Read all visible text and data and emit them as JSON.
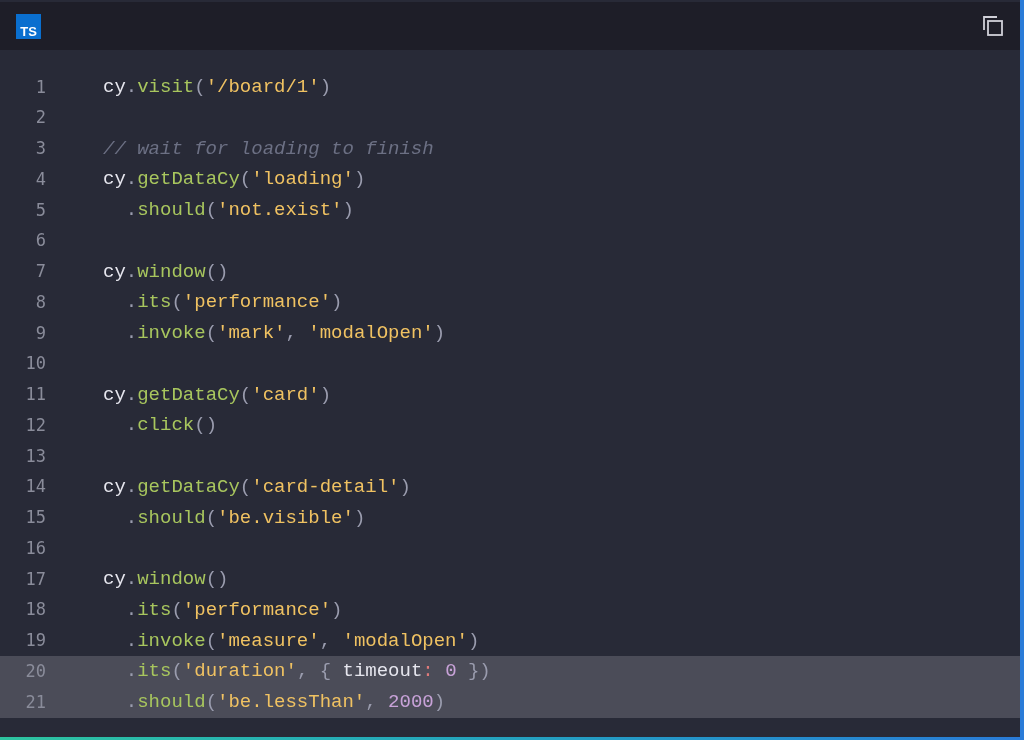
{
  "header": {
    "badge": "TS"
  },
  "lines": [
    {
      "number": "1",
      "highlighted": false,
      "tokens": [
        {
          "kind": "plain",
          "text": "cy"
        },
        {
          "kind": "punct",
          "text": "."
        },
        {
          "kind": "func",
          "text": "visit"
        },
        {
          "kind": "punct",
          "text": "("
        },
        {
          "kind": "string",
          "text": "'/board/1'"
        },
        {
          "kind": "punct",
          "text": ")"
        }
      ]
    },
    {
      "number": "2",
      "highlighted": false
    },
    {
      "number": "3",
      "highlighted": false,
      "tokens": [
        {
          "kind": "comment",
          "text": "// wait for loading to finish"
        }
      ]
    },
    {
      "number": "4",
      "highlighted": false,
      "tokens": [
        {
          "kind": "plain",
          "text": "cy"
        },
        {
          "kind": "punct",
          "text": "."
        },
        {
          "kind": "func",
          "text": "getDataCy"
        },
        {
          "kind": "punct",
          "text": "("
        },
        {
          "kind": "string",
          "text": "'loading'"
        },
        {
          "kind": "punct",
          "text": ")"
        }
      ]
    },
    {
      "number": "5",
      "highlighted": false,
      "tokens": [
        {
          "kind": "punct",
          "text": "  ."
        },
        {
          "kind": "func",
          "text": "should"
        },
        {
          "kind": "punct",
          "text": "("
        },
        {
          "kind": "string",
          "text": "'not.exist'"
        },
        {
          "kind": "punct",
          "text": ")"
        }
      ]
    },
    {
      "number": "6",
      "highlighted": false
    },
    {
      "number": "7",
      "highlighted": false,
      "tokens": [
        {
          "kind": "plain",
          "text": "cy"
        },
        {
          "kind": "punct",
          "text": "."
        },
        {
          "kind": "func",
          "text": "window"
        },
        {
          "kind": "punct",
          "text": "()"
        }
      ]
    },
    {
      "number": "8",
      "highlighted": false,
      "tokens": [
        {
          "kind": "punct",
          "text": "  ."
        },
        {
          "kind": "func",
          "text": "its"
        },
        {
          "kind": "punct",
          "text": "("
        },
        {
          "kind": "string",
          "text": "'performance'"
        },
        {
          "kind": "punct",
          "text": ")"
        }
      ]
    },
    {
      "number": "9",
      "highlighted": false,
      "tokens": [
        {
          "kind": "punct",
          "text": "  ."
        },
        {
          "kind": "func",
          "text": "invoke"
        },
        {
          "kind": "punct",
          "text": "("
        },
        {
          "kind": "string",
          "text": "'mark'"
        },
        {
          "kind": "punct",
          "text": ", "
        },
        {
          "kind": "string",
          "text": "'modalOpen'"
        },
        {
          "kind": "punct",
          "text": ")"
        }
      ]
    },
    {
      "number": "10",
      "highlighted": false
    },
    {
      "number": "11",
      "highlighted": false,
      "tokens": [
        {
          "kind": "plain",
          "text": "cy"
        },
        {
          "kind": "punct",
          "text": "."
        },
        {
          "kind": "func",
          "text": "getDataCy"
        },
        {
          "kind": "punct",
          "text": "("
        },
        {
          "kind": "string",
          "text": "'card'"
        },
        {
          "kind": "punct",
          "text": ")"
        }
      ]
    },
    {
      "number": "12",
      "highlighted": false,
      "tokens": [
        {
          "kind": "punct",
          "text": "  ."
        },
        {
          "kind": "func",
          "text": "click"
        },
        {
          "kind": "punct",
          "text": "()"
        }
      ]
    },
    {
      "number": "13",
      "highlighted": false
    },
    {
      "number": "14",
      "highlighted": false,
      "tokens": [
        {
          "kind": "plain",
          "text": "cy"
        },
        {
          "kind": "punct",
          "text": "."
        },
        {
          "kind": "func",
          "text": "getDataCy"
        },
        {
          "kind": "punct",
          "text": "("
        },
        {
          "kind": "string",
          "text": "'card-detail'"
        },
        {
          "kind": "punct",
          "text": ")"
        }
      ]
    },
    {
      "number": "15",
      "highlighted": false,
      "tokens": [
        {
          "kind": "punct",
          "text": "  ."
        },
        {
          "kind": "func",
          "text": "should"
        },
        {
          "kind": "punct",
          "text": "("
        },
        {
          "kind": "string",
          "text": "'be.visible'"
        },
        {
          "kind": "punct",
          "text": ")"
        }
      ]
    },
    {
      "number": "16",
      "highlighted": false
    },
    {
      "number": "17",
      "highlighted": false,
      "tokens": [
        {
          "kind": "plain",
          "text": "cy"
        },
        {
          "kind": "punct",
          "text": "."
        },
        {
          "kind": "func",
          "text": "window"
        },
        {
          "kind": "punct",
          "text": "()"
        }
      ]
    },
    {
      "number": "18",
      "highlighted": false,
      "tokens": [
        {
          "kind": "punct",
          "text": "  ."
        },
        {
          "kind": "func",
          "text": "its"
        },
        {
          "kind": "punct",
          "text": "("
        },
        {
          "kind": "string",
          "text": "'performance'"
        },
        {
          "kind": "punct",
          "text": ")"
        }
      ]
    },
    {
      "number": "19",
      "highlighted": false,
      "tokens": [
        {
          "kind": "punct",
          "text": "  ."
        },
        {
          "kind": "func",
          "text": "invoke"
        },
        {
          "kind": "punct",
          "text": "("
        },
        {
          "kind": "string",
          "text": "'measure'"
        },
        {
          "kind": "punct",
          "text": ", "
        },
        {
          "kind": "string",
          "text": "'modalOpen'"
        },
        {
          "kind": "punct",
          "text": ")"
        }
      ]
    },
    {
      "number": "20",
      "highlighted": true,
      "tokens": [
        {
          "kind": "punct",
          "text": "  ."
        },
        {
          "kind": "func",
          "text": "its"
        },
        {
          "kind": "punct",
          "text": "("
        },
        {
          "kind": "string",
          "text": "'duration'"
        },
        {
          "kind": "punct",
          "text": ", { "
        },
        {
          "kind": "plain",
          "text": "timeout"
        },
        {
          "kind": "operator",
          "text": ": "
        },
        {
          "kind": "number",
          "text": "0"
        },
        {
          "kind": "punct",
          "text": " })"
        }
      ]
    },
    {
      "number": "21",
      "highlighted": true,
      "tokens": [
        {
          "kind": "punct",
          "text": "  ."
        },
        {
          "kind": "func",
          "text": "should"
        },
        {
          "kind": "punct",
          "text": "("
        },
        {
          "kind": "string",
          "text": "'be.lessThan'"
        },
        {
          "kind": "punct",
          "text": ", "
        },
        {
          "kind": "number",
          "text": "2000"
        },
        {
          "kind": "punct",
          "text": ")"
        }
      ]
    }
  ]
}
